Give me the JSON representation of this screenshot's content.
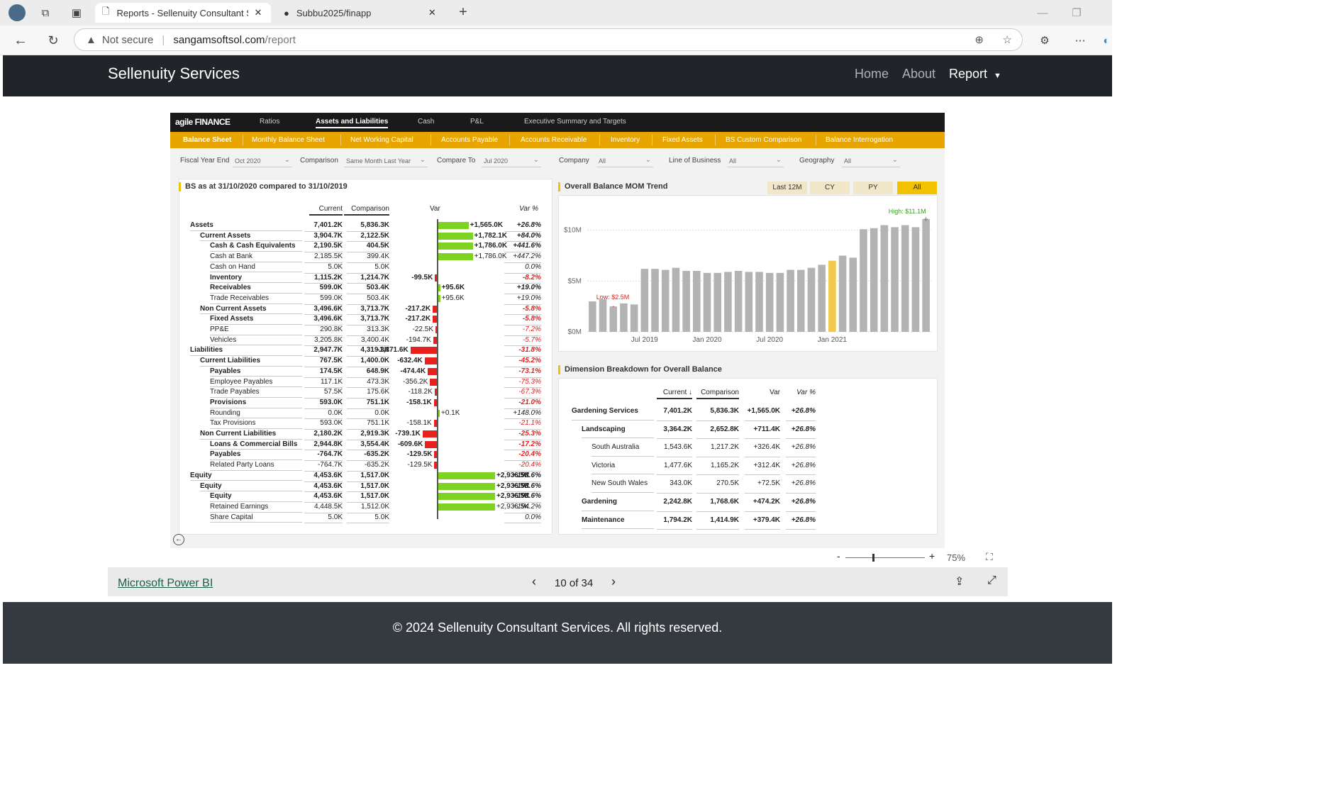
{
  "browser": {
    "tabs": [
      {
        "label": "Reports - Sellenuity Consultant Se"
      },
      {
        "label": "Subbu2025/finapp"
      }
    ],
    "security": "Not secure",
    "url_domain": "sangamsoftsol.com",
    "url_path": "/report"
  },
  "nav": {
    "brand": "Sellenuity Services",
    "links": [
      "Home",
      "About",
      "Report"
    ]
  },
  "report": {
    "logo": "agile FINANCE",
    "top_tabs": [
      "Ratios",
      "Assets and Liabilities",
      "Cash",
      "P&L",
      "Executive Summary and Targets"
    ],
    "sub_tabs": [
      "Balance Sheet",
      "Monthly Balance Sheet",
      "Net Working Capital",
      "Accounts Payable",
      "Accounts Receivable",
      "Inventory",
      "Fixed Assets",
      "BS Custom Comparison",
      "Balance Interrogation"
    ],
    "filters": [
      {
        "label": "Fiscal Year End",
        "value": "Oct 2020"
      },
      {
        "label": "Comparison",
        "value": "Same Month Last Year"
      },
      {
        "label": "Compare To",
        "value": "Jul 2020"
      },
      {
        "label": "Company",
        "value": "All"
      },
      {
        "label": "Line of Business",
        "value": "All"
      },
      {
        "label": "Geography",
        "value": "All"
      }
    ],
    "bs": {
      "title": "BS as at 31/10/2020 compared to 31/10/2019",
      "headers": {
        "current": "Current",
        "comparison": "Comparison",
        "var": "Var",
        "varpct": "Var %"
      },
      "rows": [
        {
          "label": "Assets",
          "indent": 0,
          "bold": true,
          "cur": "7,401.2K",
          "cmp": "5,836.3K",
          "var": "+1,565.0K",
          "v": 1565.0,
          "pct": "+26.8%"
        },
        {
          "label": "Current Assets",
          "indent": 1,
          "bold": true,
          "cur": "3,904.7K",
          "cmp": "2,122.5K",
          "var": "+1,782.1K",
          "v": 1782.1,
          "pct": "+84.0%"
        },
        {
          "label": "Cash & Cash Equivalents",
          "indent": 2,
          "bold": true,
          "cur": "2,190.5K",
          "cmp": "404.5K",
          "var": "+1,786.0K",
          "v": 1786.0,
          "pct": "+441.6%"
        },
        {
          "label": "Cash at Bank",
          "indent": 2,
          "bold": false,
          "cur": "2,185.5K",
          "cmp": "399.4K",
          "var": "+1,786.0K",
          "v": 1786.0,
          "pct": "+447.2%"
        },
        {
          "label": "Cash on Hand",
          "indent": 2,
          "bold": false,
          "cur": "5.0K",
          "cmp": "5.0K",
          "var": "",
          "v": 0,
          "pct": "0.0%"
        },
        {
          "label": "Inventory",
          "indent": 2,
          "bold": true,
          "cur": "1,115.2K",
          "cmp": "1,214.7K",
          "var": "-99.5K",
          "v": -99.5,
          "pct": "-8.2%"
        },
        {
          "label": "Receivables",
          "indent": 2,
          "bold": true,
          "cur": "599.0K",
          "cmp": "503.4K",
          "var": "+95.6K",
          "v": 95.6,
          "pct": "+19.0%"
        },
        {
          "label": "Trade Receivables",
          "indent": 2,
          "bold": false,
          "cur": "599.0K",
          "cmp": "503.4K",
          "var": "+95.6K",
          "v": 95.6,
          "pct": "+19.0%"
        },
        {
          "label": "Non Current Assets",
          "indent": 1,
          "bold": true,
          "cur": "3,496.6K",
          "cmp": "3,713.7K",
          "var": "-217.2K",
          "v": -217.2,
          "pct": "-5.8%"
        },
        {
          "label": "Fixed Assets",
          "indent": 2,
          "bold": true,
          "cur": "3,496.6K",
          "cmp": "3,713.7K",
          "var": "-217.2K",
          "v": -217.2,
          "pct": "-5.8%"
        },
        {
          "label": "PP&E",
          "indent": 2,
          "bold": false,
          "cur": "290.8K",
          "cmp": "313.3K",
          "var": "-22.5K",
          "v": -22.5,
          "pct": "-7.2%"
        },
        {
          "label": "Vehicles",
          "indent": 2,
          "bold": false,
          "cur": "3,205.8K",
          "cmp": "3,400.4K",
          "var": "-194.7K",
          "v": -194.7,
          "pct": "-5.7%"
        },
        {
          "label": "Liabilities",
          "indent": 0,
          "bold": true,
          "cur": "2,947.7K",
          "cmp": "4,319.3K",
          "var": "-1,371.6K",
          "v": -1371.6,
          "pct": "-31.8%"
        },
        {
          "label": "Current Liabilities",
          "indent": 1,
          "bold": true,
          "cur": "767.5K",
          "cmp": "1,400.0K",
          "var": "-632.4K",
          "v": -632.4,
          "pct": "-45.2%"
        },
        {
          "label": "Payables",
          "indent": 2,
          "bold": true,
          "cur": "174.5K",
          "cmp": "648.9K",
          "var": "-474.4K",
          "v": -474.4,
          "pct": "-73.1%"
        },
        {
          "label": "Employee Payables",
          "indent": 2,
          "bold": false,
          "cur": "117.1K",
          "cmp": "473.3K",
          "var": "-356.2K",
          "v": -356.2,
          "pct": "-75.3%"
        },
        {
          "label": "Trade Payables",
          "indent": 2,
          "bold": false,
          "cur": "57.5K",
          "cmp": "175.6K",
          "var": "-118.2K",
          "v": -118.2,
          "pct": "-67.3%"
        },
        {
          "label": "Provisions",
          "indent": 2,
          "bold": true,
          "cur": "593.0K",
          "cmp": "751.1K",
          "var": "-158.1K",
          "v": -158.1,
          "pct": "-21.0%"
        },
        {
          "label": "Rounding",
          "indent": 2,
          "bold": false,
          "cur": "0.0K",
          "cmp": "0.0K",
          "var": "+0.1K",
          "v": 0.1,
          "pct": "+148.0%"
        },
        {
          "label": "Tax Provisions",
          "indent": 2,
          "bold": false,
          "cur": "593.0K",
          "cmp": "751.1K",
          "var": "-158.1K",
          "v": -158.1,
          "pct": "-21.1%"
        },
        {
          "label": "Non Current Liabilities",
          "indent": 1,
          "bold": true,
          "cur": "2,180.2K",
          "cmp": "2,919.3K",
          "var": "-739.1K",
          "v": -739.1,
          "pct": "-25.3%"
        },
        {
          "label": "Loans & Commercial Bills",
          "indent": 2,
          "bold": true,
          "cur": "2,944.8K",
          "cmp": "3,554.4K",
          "var": "-609.6K",
          "v": -609.6,
          "pct": "-17.2%"
        },
        {
          "label": "Payables",
          "indent": 2,
          "bold": true,
          "cur": "-764.7K",
          "cmp": "-635.2K",
          "var": "-129.5K",
          "v": -129.5,
          "pct": "-20.4%"
        },
        {
          "label": "Related Party Loans",
          "indent": 2,
          "bold": false,
          "cur": "-764.7K",
          "cmp": "-635.2K",
          "var": "-129.5K",
          "v": -129.5,
          "pct": "-20.4%"
        },
        {
          "label": "Equity",
          "indent": 0,
          "bold": true,
          "cur": "4,453.6K",
          "cmp": "1,517.0K",
          "var": "+2,936.5K",
          "v": 2936.5,
          "pct": "+193.6%"
        },
        {
          "label": "Equity",
          "indent": 1,
          "bold": true,
          "cur": "4,453.6K",
          "cmp": "1,517.0K",
          "var": "+2,936.5K",
          "v": 2936.5,
          "pct": "+193.6%"
        },
        {
          "label": "Equity",
          "indent": 2,
          "bold": true,
          "cur": "4,453.6K",
          "cmp": "1,517.0K",
          "var": "+2,936.5K",
          "v": 2936.5,
          "pct": "+193.6%"
        },
        {
          "label": "Retained Earnings",
          "indent": 2,
          "bold": false,
          "cur": "4,448.5K",
          "cmp": "1,512.0K",
          "var": "+2,936.5K",
          "v": 2936.5,
          "pct": "+194.2%"
        },
        {
          "label": "Share Capital",
          "indent": 2,
          "bold": false,
          "cur": "5.0K",
          "cmp": "5.0K",
          "var": "",
          "v": 0,
          "pct": "0.0%"
        }
      ]
    },
    "trend": {
      "title": "Overall Balance MOM Trend",
      "chips": [
        "Last 12M",
        "CY",
        "PY",
        "All"
      ],
      "active_chip": "All",
      "high_label": "High: $11.1M",
      "low_label": "Low: $2.5M",
      "y_ticks": [
        "$10M",
        "$5M",
        "$0M"
      ],
      "x_ticks": [
        "Jul 2019",
        "Jan 2020",
        "Jul 2020",
        "Jan 2021"
      ]
    },
    "dim": {
      "title": "Dimension Breakdown for Overall Balance",
      "headers": {
        "current": "Current ↓",
        "comparison": "Comparison",
        "var": "Var",
        "varpct": "Var %"
      },
      "rows": [
        {
          "label": "Gardening Services",
          "indent": 0,
          "bold": true,
          "cur": "7,401.2K",
          "cmp": "5,836.3K",
          "var": "+1,565.0K",
          "pct": "+26.8%"
        },
        {
          "label": "Landscaping",
          "indent": 1,
          "bold": true,
          "cur": "3,364.2K",
          "cmp": "2,652.8K",
          "var": "+711.4K",
          "pct": "+26.8%"
        },
        {
          "label": "South Australia",
          "indent": 2,
          "bold": false,
          "cur": "1,543.6K",
          "cmp": "1,217.2K",
          "var": "+326.4K",
          "pct": "+26.8%"
        },
        {
          "label": "Victoria",
          "indent": 2,
          "bold": false,
          "cur": "1,477.6K",
          "cmp": "1,165.2K",
          "var": "+312.4K",
          "pct": "+26.8%"
        },
        {
          "label": "New South Wales",
          "indent": 2,
          "bold": false,
          "cur": "343.0K",
          "cmp": "270.5K",
          "var": "+72.5K",
          "pct": "+26.8%"
        },
        {
          "label": "Gardening",
          "indent": 1,
          "bold": true,
          "cur": "2,242.8K",
          "cmp": "1,768.6K",
          "var": "+474.2K",
          "pct": "+26.8%"
        },
        {
          "label": "Maintenance",
          "indent": 1,
          "bold": true,
          "cur": "1,794.2K",
          "cmp": "1,414.9K",
          "var": "+379.4K",
          "pct": "+26.8%"
        }
      ]
    }
  },
  "chart_data": {
    "type": "bar",
    "title": "Overall Balance MOM Trend",
    "xlabel": "",
    "ylabel": "",
    "ylim": [
      0,
      12
    ],
    "y_unit": "$M",
    "x_ticks": [
      "Jul 2019",
      "Jan 2020",
      "Jul 2020",
      "Jan 2021"
    ],
    "values": [
      3.0,
      3.2,
      2.5,
      2.8,
      2.7,
      6.2,
      6.2,
      6.1,
      6.3,
      6.0,
      6.0,
      5.8,
      5.8,
      5.9,
      6.0,
      5.9,
      5.9,
      5.8,
      5.8,
      6.1,
      6.1,
      6.3,
      6.6,
      7.0,
      7.5,
      7.3,
      10.1,
      10.2,
      10.5,
      10.3,
      10.5,
      10.3,
      11.1
    ],
    "highlight_index": 23,
    "colors": {
      "bar": "#b3b3b3",
      "highlight": "#f2c94c"
    }
  },
  "zoom": {
    "minus": "-",
    "plus": "+",
    "level": "75%"
  },
  "pbi": {
    "link": "Microsoft Power BI",
    "page": "10 of 34"
  },
  "footer": {
    "text": "© 2024 Sellenuity Consultant Services. All rights reserved."
  }
}
